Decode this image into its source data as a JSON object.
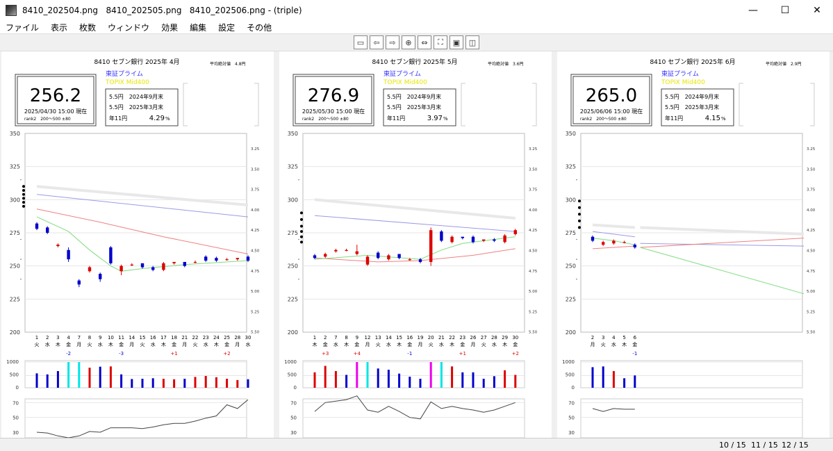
{
  "window": {
    "title": "8410_202504.png   8410_202505.png   8410_202506.png - (triple)",
    "minimize": "—",
    "maximize": "☐",
    "close": "✕"
  },
  "menu": [
    "ファイル",
    "表示",
    "枚数",
    "ウィンドウ",
    "効果",
    "編集",
    "設定",
    "その他"
  ],
  "toolbar_icons": [
    "window-icon",
    "arrow-left-icon",
    "arrow-right-icon",
    "fit-width-icon",
    "fit-height-icon",
    "fullscreen-icon",
    "photo-icon",
    "two-page-icon"
  ],
  "colors": {
    "blue": "#0000cc",
    "red": "#dd0000",
    "cyan": "#00e5e5",
    "magenta": "#ee00ee",
    "topix": "#e6e600",
    "ma_blue": "#9a9ae6",
    "ma_red": "#f08080",
    "ma_green": "#7fdc7f"
  },
  "status": {
    "pages": [
      "10 / 15",
      "11 / 15",
      "12 / 15"
    ]
  },
  "panels": [
    {
      "title": "8410 セブン銀行 2025年 4月",
      "avg_label": "平均絶対値　4.8円",
      "exchange": "東証プライム",
      "index": "TOPIX Mid400",
      "price": "256.2",
      "datetime": "2025/04/30 15:00 現在",
      "rank": "rank2　200～500 ±80",
      "div1": "5.5円　2024年9月末",
      "div2": "5.5円　2025年3月末",
      "annual_label": "年11円",
      "yield": "4.29",
      "yield_unit": "%",
      "y_ticks": [
        "350",
        "325",
        "300",
        "275",
        "250",
        "225",
        "200"
      ],
      "r_ticks": [
        "3.25",
        "3.50",
        "3.75",
        "4.00",
        "4.25",
        "4.50",
        "4.75",
        "5.00",
        "5.25",
        "5.50"
      ],
      "dates": [
        "1",
        "2",
        "3",
        "4",
        "7",
        "8",
        "9",
        "10",
        "11",
        "14",
        "15",
        "16",
        "17",
        "18",
        "21",
        "22",
        "23",
        "24",
        "25",
        "28",
        "30"
      ],
      "weekdays": [
        "火",
        "水",
        "木",
        "金",
        "月",
        "火",
        "水",
        "木",
        "金",
        "月",
        "火",
        "水",
        "木",
        "金",
        "月",
        "火",
        "水",
        "木",
        "金",
        "月",
        "水"
      ],
      "marks": [
        {
          "i": 3,
          "t": "-2",
          "c": "blue"
        },
        {
          "i": 8,
          "t": "-3",
          "c": "blue"
        },
        {
          "i": 13,
          "t": "+1",
          "c": "red"
        },
        {
          "i": 18,
          "t": "+2",
          "c": "red"
        }
      ],
      "vol_ticks": [
        "1000",
        "500",
        "0"
      ],
      "sub_ticks": [
        "70",
        "50",
        "30"
      ],
      "chart_data": {
        "type": "candlestick",
        "ylim": [
          200,
          350
        ],
        "candles": [
          {
            "o": 282,
            "c": 278,
            "h": 283,
            "l": 277
          },
          {
            "o": 279,
            "c": 275,
            "h": 280,
            "l": 274
          },
          {
            "o": 265,
            "c": 266,
            "h": 267,
            "l": 264
          },
          {
            "o": 262,
            "c": 255,
            "h": 264,
            "l": 253
          },
          {
            "o": 239,
            "c": 236,
            "h": 240,
            "l": 234
          },
          {
            "o": 246,
            "c": 249,
            "h": 250,
            "l": 245
          },
          {
            "o": 244,
            "c": 240,
            "h": 245,
            "l": 238
          },
          {
            "o": 264,
            "c": 252,
            "h": 265,
            "l": 251
          },
          {
            "o": 246,
            "c": 250,
            "h": 251,
            "l": 243
          },
          {
            "o": 251,
            "c": 251,
            "h": 252,
            "l": 250
          },
          {
            "o": 252,
            "c": 249,
            "h": 252,
            "l": 248
          },
          {
            "o": 249,
            "c": 247,
            "h": 250,
            "l": 246
          },
          {
            "o": 247,
            "c": 252,
            "h": 253,
            "l": 246
          },
          {
            "o": 252,
            "c": 253,
            "h": 253,
            "l": 251
          },
          {
            "o": 253,
            "c": 250,
            "h": 253,
            "l": 249
          },
          {
            "o": 253,
            "c": 253,
            "h": 254,
            "l": 252
          },
          {
            "o": 257,
            "c": 254,
            "h": 258,
            "l": 253
          },
          {
            "o": 256,
            "c": 254,
            "h": 257,
            "l": 253
          },
          {
            "o": 255,
            "c": 255,
            "h": 256,
            "l": 254
          },
          {
            "o": 255,
            "c": 256,
            "h": 256,
            "l": 254
          },
          {
            "o": 257,
            "c": 254,
            "h": 258,
            "l": 253
          }
        ],
        "volume": [
          {
            "v": 560,
            "c": "blue"
          },
          {
            "v": 520,
            "c": "blue"
          },
          {
            "v": 650,
            "c": "blue"
          },
          {
            "v": 1000,
            "c": "cyan"
          },
          {
            "v": 1000,
            "c": "cyan"
          },
          {
            "v": 780,
            "c": "red"
          },
          {
            "v": 820,
            "c": "blue"
          },
          {
            "v": 830,
            "c": "red"
          },
          {
            "v": 520,
            "c": "blue"
          },
          {
            "v": 340,
            "c": "blue"
          },
          {
            "v": 350,
            "c": "blue"
          },
          {
            "v": 370,
            "c": "blue"
          },
          {
            "v": 350,
            "c": "red"
          },
          {
            "v": 330,
            "c": "red"
          },
          {
            "v": 350,
            "c": "blue"
          },
          {
            "v": 420,
            "c": "red"
          },
          {
            "v": 460,
            "c": "red"
          },
          {
            "v": 410,
            "c": "red"
          },
          {
            "v": 350,
            "c": "red"
          },
          {
            "v": 300,
            "c": "red"
          },
          {
            "v": 330,
            "c": "blue"
          }
        ],
        "sub": [
          30,
          29,
          25,
          21,
          25,
          31,
          30,
          36,
          36,
          36,
          35,
          37,
          40,
          42,
          42,
          45,
          49,
          52,
          67,
          62,
          74
        ],
        "ma_gray": [
          [
            0,
            310
          ],
          [
            20,
            296
          ]
        ],
        "ma_blue": [
          [
            0,
            304
          ],
          [
            20,
            287
          ]
        ],
        "ma_red": [
          [
            0,
            293
          ],
          [
            6,
            283
          ],
          [
            12,
            272
          ],
          [
            20,
            259
          ]
        ],
        "ma_green": [
          [
            0,
            287
          ],
          [
            3,
            276
          ],
          [
            5,
            262
          ],
          [
            7,
            250
          ],
          [
            8,
            246
          ],
          [
            10,
            248
          ],
          [
            14,
            251
          ],
          [
            20,
            254
          ]
        ],
        "dots": [
          310,
          307,
          304,
          301,
          298,
          295
        ]
      }
    },
    {
      "title": "8410 セブン銀行 2025年 5月",
      "avg_label": "平均絶対値　3.6円",
      "exchange": "東証プライム",
      "index": "TOPIX Mid400",
      "price": "276.9",
      "datetime": "2025/05/30 15:00 現在",
      "rank": "rank2　200～500 ±80",
      "div1": "5.5円　2024年9月末",
      "div2": "5.5円　2025年3月末",
      "annual_label": "年11円",
      "yield": "3.97",
      "yield_unit": "%",
      "y_ticks": [
        "350",
        "325",
        "300",
        "275",
        "250",
        "225",
        "200"
      ],
      "r_ticks": [
        "3.25",
        "3.50",
        "3.75",
        "4.00",
        "4.25",
        "4.50",
        "4.75",
        "5.00",
        "5.25",
        "5.50"
      ],
      "dates": [
        "1",
        "2",
        "7",
        "8",
        "9",
        "12",
        "13",
        "14",
        "15",
        "16",
        "19",
        "20",
        "21",
        "22",
        "23",
        "26",
        "27",
        "28",
        "29",
        "30"
      ],
      "weekdays": [
        "木",
        "金",
        "水",
        "木",
        "金",
        "月",
        "火",
        "水",
        "木",
        "金",
        "月",
        "火",
        "水",
        "木",
        "金",
        "月",
        "火",
        "水",
        "木",
        "金"
      ],
      "marks": [
        {
          "i": 1,
          "t": "+3",
          "c": "red"
        },
        {
          "i": 4,
          "t": "+4",
          "c": "red"
        },
        {
          "i": 9,
          "t": "-1",
          "c": "blue"
        },
        {
          "i": 14,
          "t": "+1",
          "c": "red"
        },
        {
          "i": 19,
          "t": "+2",
          "c": "red"
        }
      ],
      "vol_ticks": [
        "1000",
        "500",
        "0"
      ],
      "sub_ticks": [
        "70",
        "50",
        "30"
      ],
      "chart_data": {
        "type": "candlestick",
        "ylim": [
          200,
          350
        ],
        "candles": [
          {
            "o": 258,
            "c": 256,
            "h": 259,
            "l": 255
          },
          {
            "o": 257,
            "c": 259,
            "h": 260,
            "l": 256
          },
          {
            "o": 261,
            "c": 262,
            "h": 263,
            "l": 260
          },
          {
            "o": 262,
            "c": 262,
            "h": 263,
            "l": 261
          },
          {
            "o": 259,
            "c": 261,
            "h": 266,
            "l": 258
          },
          {
            "o": 251,
            "c": 257,
            "h": 258,
            "l": 250
          },
          {
            "o": 260,
            "c": 256,
            "h": 261,
            "l": 255
          },
          {
            "o": 255,
            "c": 258,
            "h": 259,
            "l": 254
          },
          {
            "o": 259,
            "c": 256,
            "h": 259,
            "l": 255
          },
          {
            "o": 255,
            "c": 255,
            "h": 256,
            "l": 254
          },
          {
            "o": 255,
            "c": 253,
            "h": 256,
            "l": 252
          },
          {
            "o": 253,
            "c": 277,
            "h": 279,
            "l": 250
          },
          {
            "o": 276,
            "c": 269,
            "h": 277,
            "l": 268
          },
          {
            "o": 268,
            "c": 272,
            "h": 273,
            "l": 267
          },
          {
            "o": 272,
            "c": 271,
            "h": 272,
            "l": 270
          },
          {
            "o": 272,
            "c": 268,
            "h": 273,
            "l": 267
          },
          {
            "o": 269,
            "c": 270,
            "h": 270,
            "l": 268
          },
          {
            "o": 270,
            "c": 269,
            "h": 271,
            "l": 268
          },
          {
            "o": 268,
            "c": 273,
            "h": 274,
            "l": 267
          },
          {
            "o": 274,
            "c": 277,
            "h": 278,
            "l": 273
          }
        ],
        "volume": [
          {
            "v": 600,
            "c": "red"
          },
          {
            "v": 850,
            "c": "red"
          },
          {
            "v": 650,
            "c": "red"
          },
          {
            "v": 500,
            "c": "blue"
          },
          {
            "v": 1000,
            "c": "magenta"
          },
          {
            "v": 1000,
            "c": "cyan"
          },
          {
            "v": 750,
            "c": "blue"
          },
          {
            "v": 700,
            "c": "blue"
          },
          {
            "v": 550,
            "c": "blue"
          },
          {
            "v": 430,
            "c": "blue"
          },
          {
            "v": 350,
            "c": "blue"
          },
          {
            "v": 1000,
            "c": "magenta"
          },
          {
            "v": 1000,
            "c": "cyan"
          },
          {
            "v": 830,
            "c": "red"
          },
          {
            "v": 600,
            "c": "blue"
          },
          {
            "v": 600,
            "c": "blue"
          },
          {
            "v": 350,
            "c": "blue"
          },
          {
            "v": 450,
            "c": "blue"
          },
          {
            "v": 680,
            "c": "red"
          },
          {
            "v": 500,
            "c": "red"
          }
        ],
        "sub": [
          58,
          70,
          72,
          74,
          79,
          60,
          57,
          65,
          58,
          50,
          48,
          71,
          62,
          65,
          62,
          60,
          57,
          60,
          65,
          70
        ],
        "ma_gray": [
          [
            0,
            300
          ],
          [
            19,
            286
          ]
        ],
        "ma_blue": [
          [
            0,
            288
          ],
          [
            19,
            276
          ]
        ],
        "ma_red": [
          [
            0,
            256
          ],
          [
            6,
            253
          ],
          [
            10,
            254
          ],
          [
            15,
            258
          ],
          [
            19,
            263
          ]
        ],
        "ma_green": [
          [
            0,
            255
          ],
          [
            5,
            258
          ],
          [
            10,
            255
          ],
          [
            12,
            262
          ],
          [
            14,
            267
          ],
          [
            19,
            272
          ]
        ],
        "dots": [
          290,
          285,
          280,
          276,
          272,
          268
        ]
      }
    },
    {
      "title": "8410 セブン銀行 2025年 6月",
      "avg_label": "平均絶対値　2.9円",
      "exchange": "東証プライム",
      "index": "TOPIX Mid400",
      "price": "265.0",
      "datetime": "2025/06/06 15:00 現在",
      "rank": "rank2　200～500 ±80",
      "div1": "5.5円　2024年9月末",
      "div2": "5.5円　2025年3月末",
      "annual_label": "年11円",
      "yield": "4.15",
      "yield_unit": "%",
      "y_ticks": [
        "350",
        "325",
        "300",
        "275",
        "250",
        "225",
        "200"
      ],
      "r_ticks": [
        "3.25",
        "3.50",
        "3.75",
        "4.00",
        "4.25",
        "4.50",
        "4.75",
        "5.00",
        "5.25",
        "5.50"
      ],
      "dates": [
        "2",
        "3",
        "4",
        "5",
        "6"
      ],
      "weekdays": [
        "月",
        "火",
        "水",
        "木",
        "金"
      ],
      "marks": [
        {
          "i": 4,
          "t": "-1",
          "c": "blue"
        }
      ],
      "vol_ticks": [
        "1000",
        "500",
        "0"
      ],
      "sub_ticks": [
        "70",
        "50",
        "30"
      ],
      "chart_data": {
        "type": "candlestick",
        "ylim": [
          200,
          350
        ],
        "candles": [
          {
            "o": 272,
            "c": 269,
            "h": 273,
            "l": 268
          },
          {
            "o": 266,
            "c": 268,
            "h": 269,
            "l": 265
          },
          {
            "o": 267,
            "c": 269,
            "h": 270,
            "l": 266
          },
          {
            "o": 268,
            "c": 268,
            "h": 269,
            "l": 267
          },
          {
            "o": 266,
            "c": 264,
            "h": 267,
            "l": 263
          }
        ],
        "volume": [
          {
            "v": 800,
            "c": "blue"
          },
          {
            "v": 830,
            "c": "blue"
          },
          {
            "v": 650,
            "c": "red"
          },
          {
            "v": 370,
            "c": "blue"
          },
          {
            "v": 480,
            "c": "blue"
          }
        ],
        "sub": [
          62,
          58,
          62,
          61,
          61
        ],
        "ma_gray": [
          [
            0,
            281
          ],
          [
            4,
            279
          ]
        ],
        "ma_blue": [
          [
            0,
            276
          ],
          [
            4,
            272
          ]
        ],
        "ma_red": [
          [
            0,
            263
          ],
          [
            4,
            265
          ]
        ],
        "ma_green": [
          [
            0,
            271
          ],
          [
            2,
            269
          ],
          [
            4,
            266
          ]
        ],
        "ext_gray": [
          [
            4.5,
            279
          ],
          [
            20,
            274
          ]
        ],
        "ext_blue": [
          [
            4.5,
            267
          ],
          [
            20,
            265
          ]
        ],
        "ext_red": [
          [
            4.5,
            264
          ],
          [
            20,
            271
          ]
        ],
        "ext_green": [
          [
            4.5,
            264
          ],
          [
            20,
            229
          ]
        ],
        "dots": [
          299,
          294,
          289,
          284,
          279
        ]
      }
    }
  ]
}
